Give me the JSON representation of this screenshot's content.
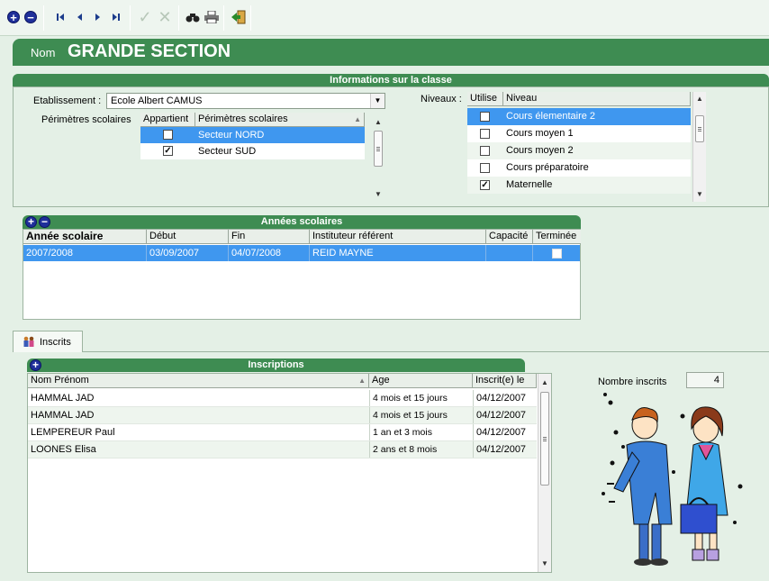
{
  "header": {
    "name_label": "Nom",
    "name_value": "GRANDE SECTION"
  },
  "info_section": {
    "title": "Informations sur la classe",
    "etablissement_label": "Etablissement :",
    "etablissement_value": "Ecole Albert CAMUS",
    "perimetres_label": "Périmètres scolaires",
    "perimetres_columns": [
      "Appartient",
      "Périmètres scolaires"
    ],
    "perimetres_rows": [
      {
        "checked": true,
        "name": "Secteur NORD",
        "selected": true
      },
      {
        "checked": true,
        "name": "Secteur SUD",
        "selected": false
      }
    ],
    "niveaux_label": "Niveaux :",
    "niveaux_columns": [
      "Utilise",
      "Niveau"
    ],
    "niveaux_rows": [
      {
        "checked": false,
        "name": "Cours élementaire 2",
        "selected": true
      },
      {
        "checked": false,
        "name": "Cours moyen 1",
        "selected": false
      },
      {
        "checked": false,
        "name": "Cours moyen 2",
        "selected": false
      },
      {
        "checked": false,
        "name": "Cours préparatoire",
        "selected": false
      },
      {
        "checked": true,
        "name": "Maternelle",
        "selected": false
      }
    ]
  },
  "annees": {
    "title": "Années scolaires",
    "columns": [
      "Année scolaire",
      "Début",
      "Fin",
      "Instituteur référent",
      "Capacité",
      "Terminée"
    ],
    "rows": [
      {
        "annee": "2007/2008",
        "debut": "03/09/2007",
        "fin": "04/07/2008",
        "instituteur": "REID MAYNE",
        "capacite": "",
        "terminee": false
      }
    ]
  },
  "tab": {
    "label": "Inscrits"
  },
  "inscriptions": {
    "title": "Inscriptions",
    "columns": [
      "Nom Prénom",
      "Age",
      "Inscrit(e) le"
    ],
    "rows": [
      {
        "nom": "HAMMAL JAD",
        "age": "4 mois et 15 jours",
        "date": "04/12/2007"
      },
      {
        "nom": "HAMMAL JAD",
        "age": "4 mois et 15 jours",
        "date": "04/12/2007"
      },
      {
        "nom": "LEMPEREUR Paul",
        "age": "1 an et 3 mois",
        "date": "04/12/2007"
      },
      {
        "nom": "LOONES Elisa",
        "age": "2 ans et 8 mois",
        "date": "04/12/2007"
      }
    ],
    "count_label": "Nombre inscrits",
    "count_value": "4"
  },
  "icons": [
    "add-icon",
    "remove-icon",
    "first-icon",
    "prev-icon",
    "next-icon",
    "last-icon",
    "validate-icon",
    "cancel-icon",
    "search-icon",
    "print-icon",
    "exit-icon",
    "children-icon",
    "students-illustration"
  ],
  "colors": {
    "accent_green": "#3e8c52",
    "selection_blue": "#3f97ef",
    "background": "#e4f0e6"
  }
}
